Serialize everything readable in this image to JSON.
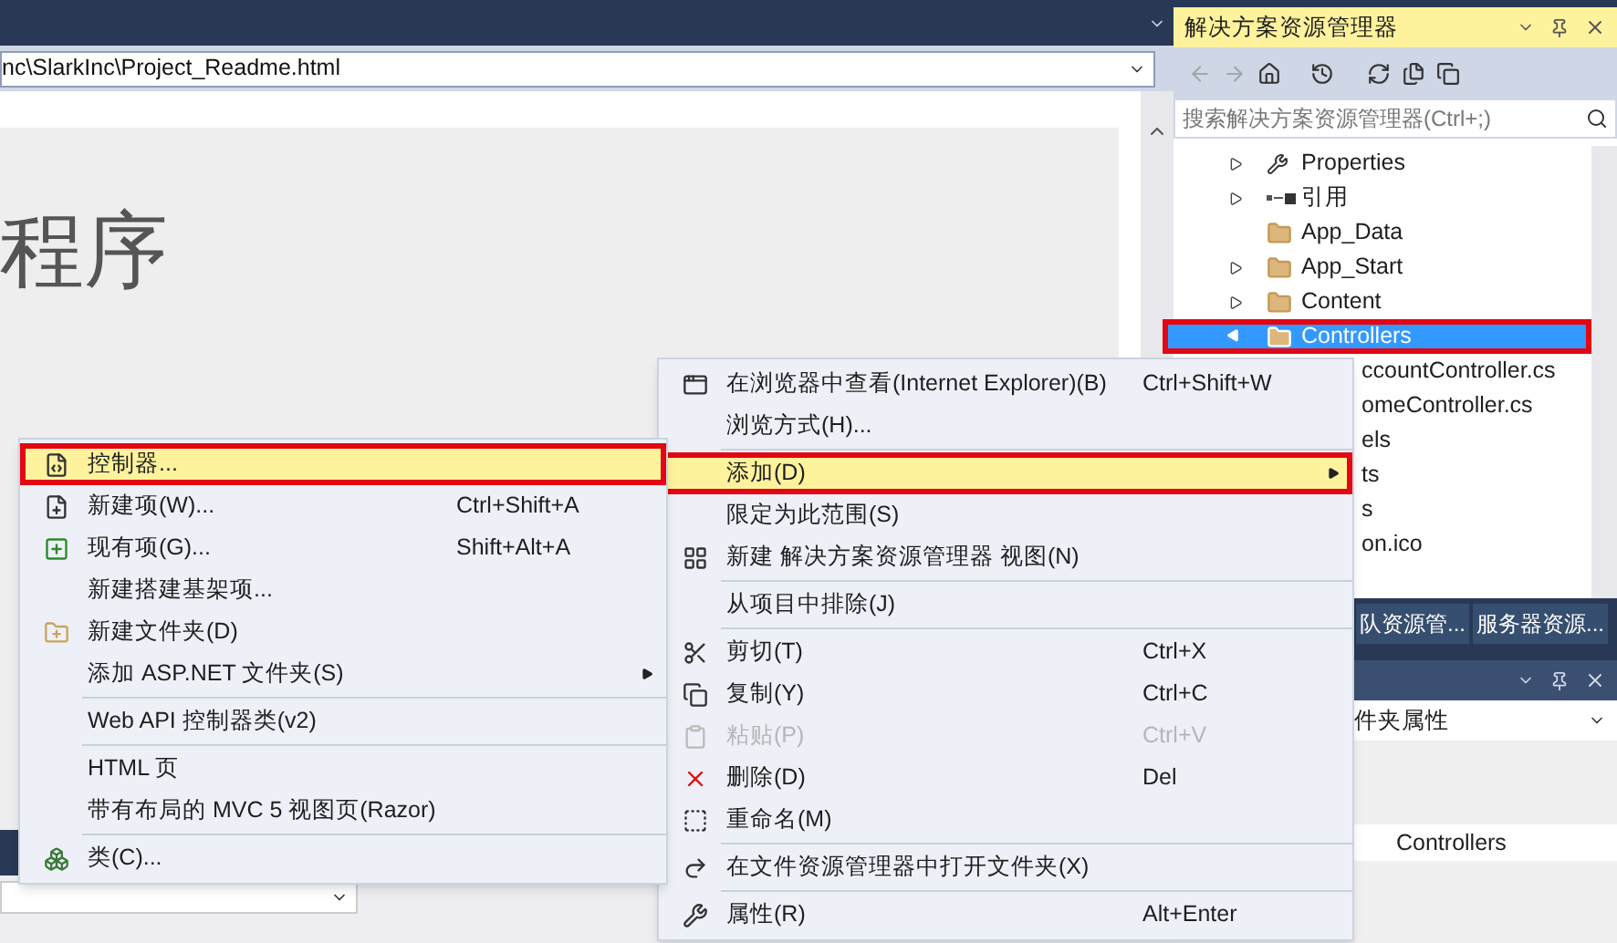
{
  "editor": {
    "address": "nc\\SlarkInc\\Project_Readme.html",
    "heading": "程序"
  },
  "solution_explorer": {
    "title": "解决方案资源管理器",
    "search": {
      "placeholder": "搜索解决方案资源管理器(Ctrl+;)"
    },
    "tree": [
      {
        "label": "Properties",
        "kind": "properties",
        "expandable": true,
        "expanded": false,
        "selected": false,
        "highlighted": false
      },
      {
        "label": "引用",
        "kind": "references",
        "expandable": true,
        "expanded": false,
        "selected": false,
        "highlighted": false
      },
      {
        "label": "App_Data",
        "kind": "folder",
        "expandable": false,
        "selected": false,
        "highlighted": false
      },
      {
        "label": "App_Start",
        "kind": "folder",
        "expandable": true,
        "expanded": false,
        "selected": false,
        "highlighted": false
      },
      {
        "label": "Content",
        "kind": "folder",
        "expandable": true,
        "expanded": false,
        "selected": false,
        "highlighted": false
      },
      {
        "label": "Controllers",
        "kind": "folder",
        "expandable": true,
        "expanded": true,
        "selected": true,
        "highlighted": true,
        "children": [
          {
            "label": "ccountController.cs",
            "kind": "clipped",
            "selected": false
          },
          {
            "label": "omeController.cs",
            "kind": "clipped",
            "selected": false
          }
        ]
      },
      {
        "label": "els",
        "kind": "clipped",
        "selected": false
      },
      {
        "label": "ts",
        "kind": "clipped",
        "selected": false
      },
      {
        "label": "s",
        "kind": "clipped",
        "selected": false
      },
      {
        "label": "on.ico",
        "kind": "clipped",
        "selected": false
      }
    ]
  },
  "bottom_tabs": [
    {
      "label": "队资源管...",
      "selected": false
    },
    {
      "label": "服务器资源...",
      "selected": false
    }
  ],
  "properties": {
    "selector": "件夹属性",
    "value": "Controllers"
  },
  "context_menu": {
    "items": [
      {
        "kind": "item",
        "label": "在浏览器中查看(Internet Explorer)(B)",
        "shortcut": "Ctrl+Shift+W",
        "submenu": false,
        "selected": false,
        "highlighted": false,
        "disabled": false
      },
      {
        "kind": "item",
        "label": "浏览方式(H)...",
        "submenu": false,
        "selected": false,
        "highlighted": false,
        "disabled": false
      },
      {
        "kind": "separator"
      },
      {
        "kind": "item",
        "label": "添加(D)",
        "submenu": true,
        "selected": true,
        "highlighted": true,
        "disabled": false
      },
      {
        "kind": "item",
        "label": "限定为此范围(S)",
        "submenu": false,
        "selected": false,
        "highlighted": false,
        "disabled": false
      },
      {
        "kind": "item",
        "label": "新建 解决方案资源管理器 视图(N)",
        "submenu": false,
        "selected": false,
        "highlighted": false,
        "disabled": false
      },
      {
        "kind": "separator"
      },
      {
        "kind": "item",
        "label": "从项目中排除(J)",
        "submenu": false,
        "selected": false,
        "highlighted": false,
        "disabled": false
      },
      {
        "kind": "separator"
      },
      {
        "kind": "item",
        "label": "剪切(T)",
        "shortcut": "Ctrl+X",
        "submenu": false,
        "selected": false,
        "highlighted": false,
        "disabled": false
      },
      {
        "kind": "item",
        "label": "复制(Y)",
        "shortcut": "Ctrl+C",
        "submenu": false,
        "selected": false,
        "highlighted": false,
        "disabled": false
      },
      {
        "kind": "item",
        "label": "粘贴(P)",
        "shortcut": "Ctrl+V",
        "submenu": false,
        "selected": false,
        "highlighted": false,
        "disabled": true
      },
      {
        "kind": "item",
        "label": "删除(D)",
        "shortcut": "Del",
        "submenu": false,
        "selected": false,
        "highlighted": false,
        "disabled": false
      },
      {
        "kind": "item",
        "label": "重命名(M)",
        "submenu": false,
        "selected": false,
        "highlighted": false,
        "disabled": false
      },
      {
        "kind": "separator"
      },
      {
        "kind": "item",
        "label": "在文件资源管理器中打开文件夹(X)",
        "submenu": false,
        "selected": false,
        "highlighted": false,
        "disabled": false
      },
      {
        "kind": "separator"
      },
      {
        "kind": "item",
        "label": "属性(R)",
        "shortcut": "Alt+Enter",
        "submenu": false,
        "selected": false,
        "highlighted": false,
        "disabled": false
      }
    ]
  },
  "add_submenu": {
    "items": [
      {
        "kind": "item",
        "label": "控制器...",
        "submenu": false,
        "selected": true,
        "highlighted": true,
        "disabled": false
      },
      {
        "kind": "item",
        "label": "新建项(W)...",
        "shortcut": "Ctrl+Shift+A",
        "submenu": false,
        "selected": false,
        "highlighted": false,
        "disabled": false
      },
      {
        "kind": "item",
        "label": "现有项(G)...",
        "shortcut": "Shift+Alt+A",
        "submenu": false,
        "selected": false,
        "highlighted": false,
        "disabled": false
      },
      {
        "kind": "item",
        "label": "新建搭建基架项...",
        "submenu": false,
        "selected": false,
        "highlighted": false,
        "disabled": false
      },
      {
        "kind": "item",
        "label": "新建文件夹(D)",
        "submenu": false,
        "selected": false,
        "highlighted": false,
        "disabled": false
      },
      {
        "kind": "item",
        "label": "添加 ASP.NET 文件夹(S)",
        "submenu": true,
        "selected": false,
        "highlighted": false,
        "disabled": false
      },
      {
        "kind": "separator"
      },
      {
        "kind": "item",
        "label": "Web API 控制器类(v2)",
        "submenu": false,
        "selected": false,
        "highlighted": false,
        "disabled": false
      },
      {
        "kind": "separator"
      },
      {
        "kind": "item",
        "label": "HTML 页",
        "submenu": false,
        "selected": false,
        "highlighted": false,
        "disabled": false
      },
      {
        "kind": "item",
        "label": "带有布局的 MVC 5 视图页(Razor)",
        "submenu": false,
        "selected": false,
        "highlighted": false,
        "disabled": false
      },
      {
        "kind": "separator"
      },
      {
        "kind": "item",
        "label": "类(C)...",
        "submenu": false,
        "selected": false,
        "highlighted": false,
        "disabled": false
      }
    ]
  }
}
